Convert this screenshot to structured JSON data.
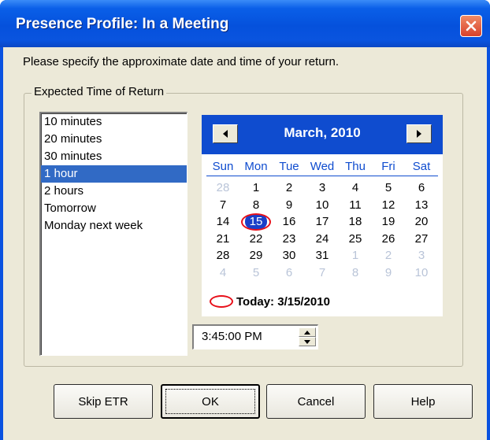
{
  "window": {
    "title": "Presence Profile: In a Meeting",
    "close_icon": "close-icon"
  },
  "prompt": "Please specify the approximate date and time of your return.",
  "group": {
    "label": "Expected Time of Return",
    "options": [
      "10 minutes",
      "20 minutes",
      "30 minutes",
      "1 hour",
      "2 hours",
      "Tomorrow",
      "Monday next week"
    ],
    "selected_index": 3
  },
  "calendar": {
    "month_label": "March, 2010",
    "weekdays": [
      "Sun",
      "Mon",
      "Tue",
      "Wed",
      "Thu",
      "Fri",
      "Sat"
    ],
    "weeks": [
      [
        "28",
        "1",
        "2",
        "3",
        "4",
        "5",
        "6"
      ],
      [
        "7",
        "8",
        "9",
        "10",
        "11",
        "12",
        "13"
      ],
      [
        "14",
        "15",
        "16",
        "17",
        "18",
        "19",
        "20"
      ],
      [
        "21",
        "22",
        "23",
        "24",
        "25",
        "26",
        "27"
      ],
      [
        "28",
        "29",
        "30",
        "31",
        "1",
        "2",
        "3"
      ],
      [
        "4",
        "5",
        "6",
        "7",
        "8",
        "9",
        "10"
      ]
    ],
    "muted_cells": [
      [
        0,
        0
      ],
      [
        4,
        4
      ],
      [
        4,
        5
      ],
      [
        4,
        6
      ],
      [
        5,
        0
      ],
      [
        5,
        1
      ],
      [
        5,
        2
      ],
      [
        5,
        3
      ],
      [
        5,
        4
      ],
      [
        5,
        5
      ],
      [
        5,
        6
      ]
    ],
    "selected_cell": [
      2,
      1
    ],
    "today_label": "Today: 3/15/2010",
    "prev_icon": "triangle-left-icon",
    "next_icon": "triangle-right-icon"
  },
  "time": {
    "value": "3:45:00 PM"
  },
  "buttons": {
    "skip": "Skip ETR",
    "ok": "OK",
    "cancel": "Cancel",
    "help": "Help"
  },
  "colors": {
    "title_bar": "#0551dc",
    "calendar_header": "#0f4ccf",
    "selection": "#316ac5",
    "today_marker": "#e8101a",
    "dialog_face": "#ece9d8"
  }
}
